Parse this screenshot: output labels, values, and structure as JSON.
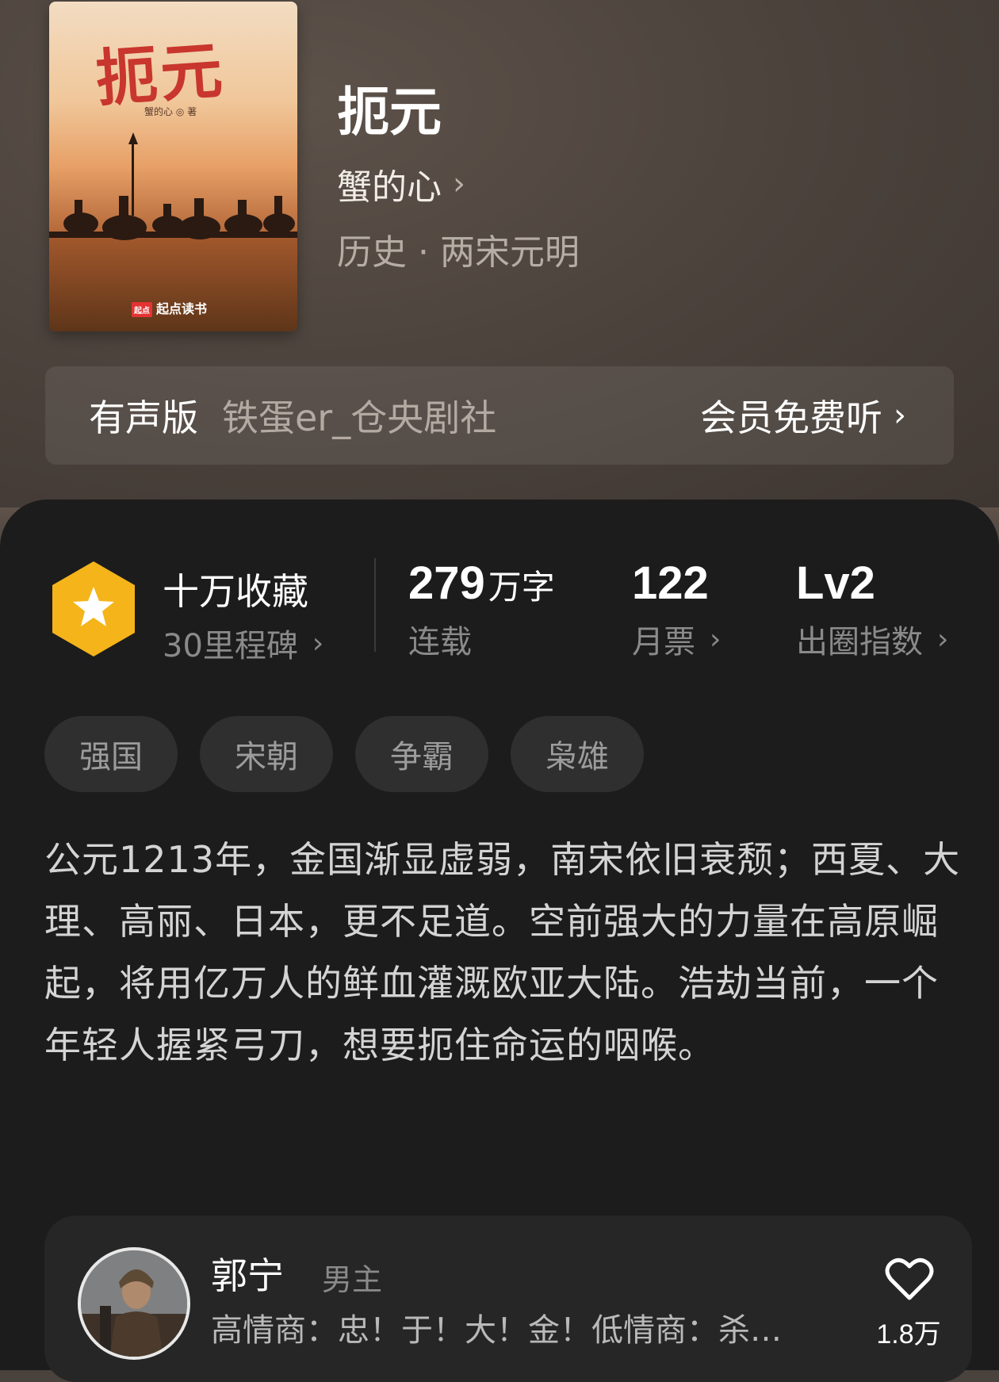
{
  "book": {
    "cover_title": "扼元",
    "cover_author": "蟹的心 ◎ 著",
    "cover_publisher": "起点读书",
    "cover_logo_text": "起点",
    "title": "扼元",
    "author": "蟹的心",
    "genre": "历史 · 两宋元明"
  },
  "audio": {
    "label": "有声版",
    "narrator": "铁蛋er_仓央剧社",
    "cta": "会员免费听"
  },
  "stats": {
    "collection_title": "十万收藏",
    "collection_sub": "30里程碑",
    "word_count": "279",
    "word_unit": "万字",
    "word_status": "连载",
    "monthly_votes": "122",
    "monthly_votes_label": "月票",
    "influence_level": "Lv2",
    "influence_label": "出圈指数"
  },
  "tags": [
    "强国",
    "宋朝",
    "争霸",
    "枭雄"
  ],
  "synopsis": "公元1213年，金国渐显虚弱，南宋依旧衰颓；西夏、大理、高丽、日本，更不足道。空前强大的力量在高原崛起，将用亿万人的鲜血灌溉欧亚大陆。浩劫当前，一个年轻人握紧弓刀，想要扼住命运的咽喉。",
  "character": {
    "name": "郭宁",
    "role": "男主",
    "quote": "高情商：忠！于！大！金！低情商：杀…",
    "likes": "1.8万"
  },
  "colors": {
    "badge_gold": "#f4b41a",
    "card_bg": "#1c1c1c",
    "tag_bg": "#2f2f2f",
    "accent_red": "#c8362e"
  },
  "icons": {
    "chevron": "›"
  }
}
